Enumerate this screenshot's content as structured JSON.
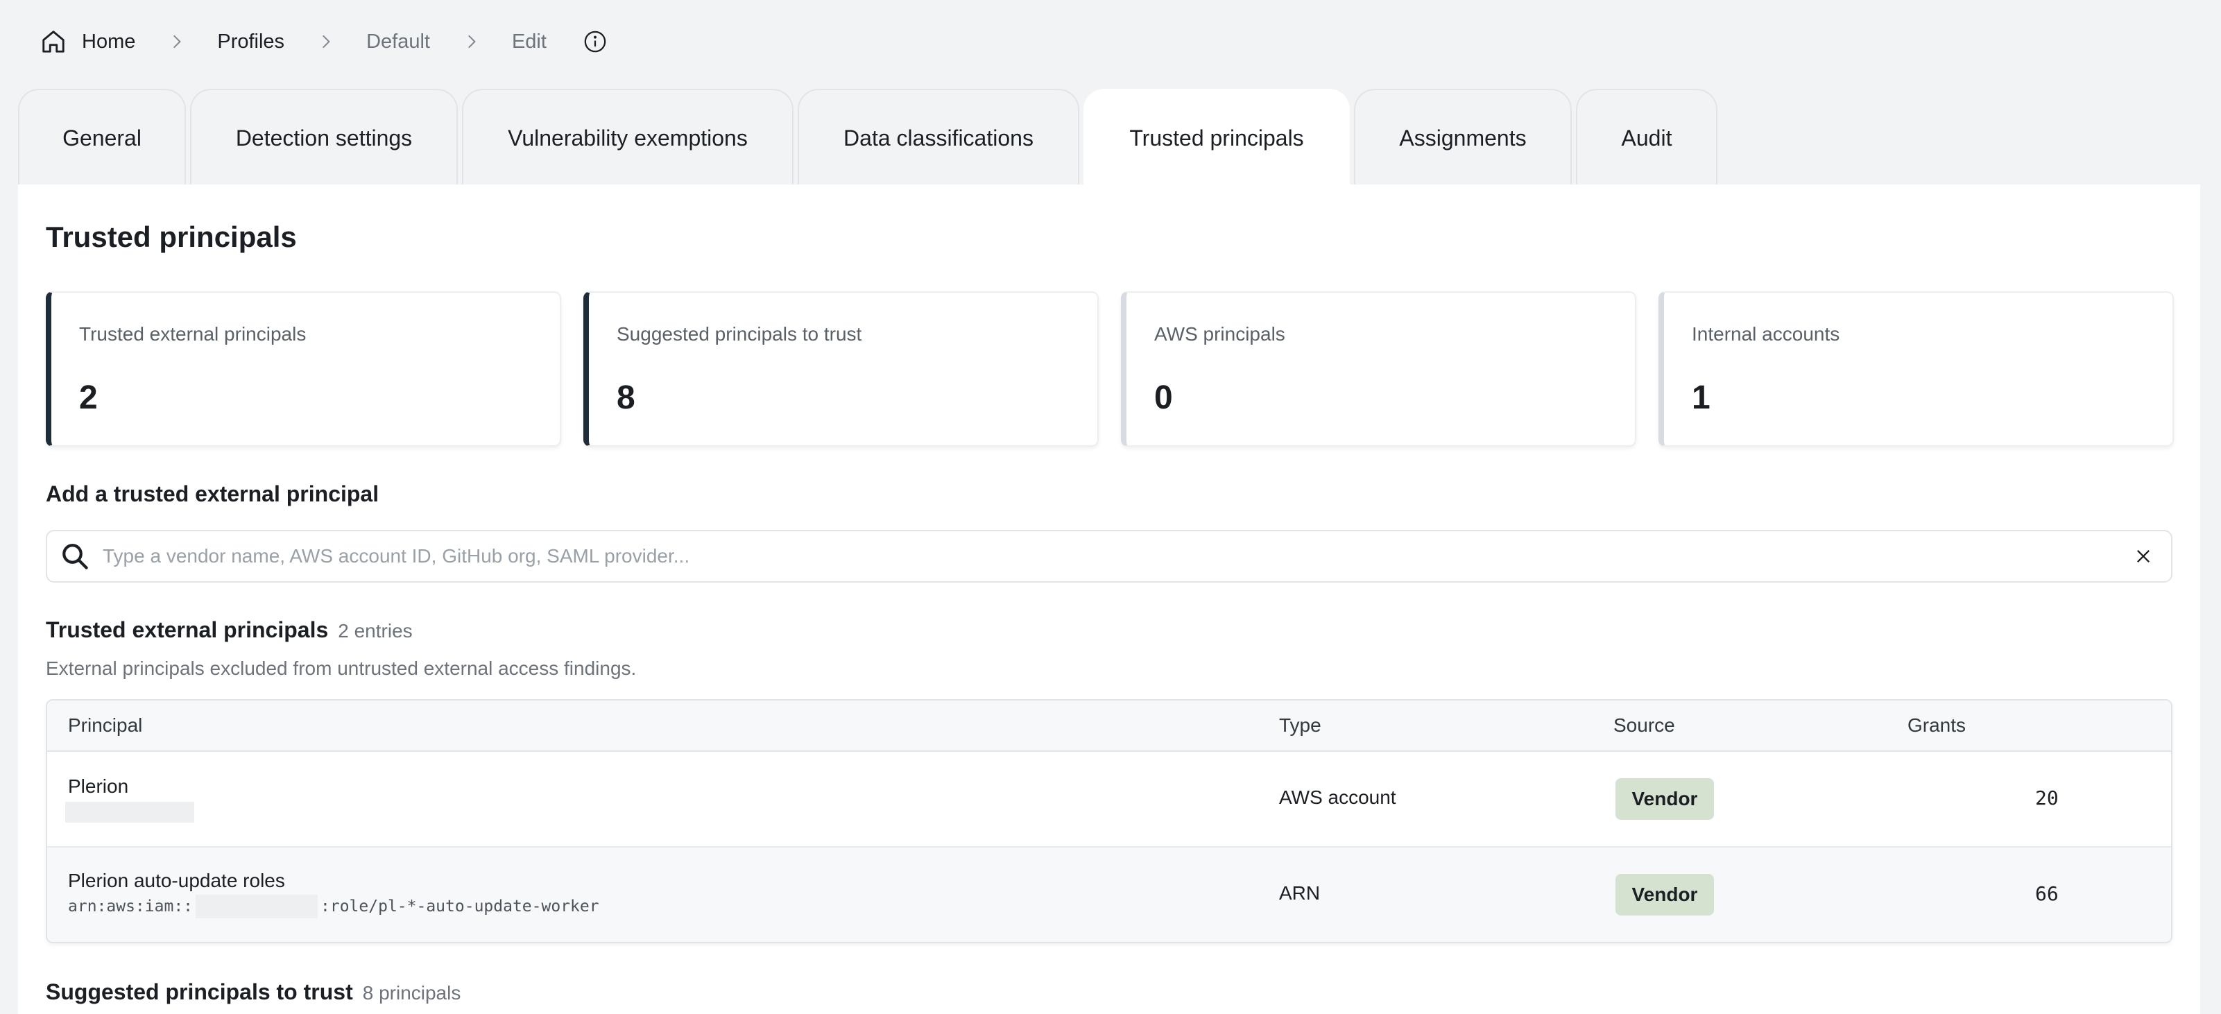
{
  "breadcrumb": {
    "items": [
      "Home",
      "Profiles",
      "Default",
      "Edit"
    ]
  },
  "tabs": [
    {
      "label": "General"
    },
    {
      "label": "Detection settings"
    },
    {
      "label": "Vulnerability exemptions"
    },
    {
      "label": "Data classifications"
    },
    {
      "label": "Trusted principals",
      "active": true
    },
    {
      "label": "Assignments"
    },
    {
      "label": "Audit"
    }
  ],
  "page": {
    "title": "Trusted principals"
  },
  "stats": [
    {
      "label": "Trusted external principals",
      "value": "2"
    },
    {
      "label": "Suggested principals to trust",
      "value": "8"
    },
    {
      "label": "AWS principals",
      "value": "0"
    },
    {
      "label": "Internal accounts",
      "value": "1"
    }
  ],
  "add": {
    "title": "Add a trusted external principal",
    "placeholder": "Type a vendor name, AWS account ID, GitHub org, SAML provider...",
    "value": ""
  },
  "trusted": {
    "title": "Trusted external principals",
    "count": "2 entries",
    "description": "External principals excluded from untrusted external access findings.",
    "columns": [
      "Principal",
      "Type",
      "Source",
      "Grants"
    ],
    "rows": [
      {
        "principal": "Plerion",
        "subtitle": "",
        "type": "AWS account",
        "source": "Vendor",
        "grants": "20"
      },
      {
        "principal": "Plerion auto-update roles",
        "arn_prefix": "arn:aws:iam::",
        "arn_suffix": ":role/pl-*-auto-update-worker",
        "type": "ARN",
        "source": "Vendor",
        "grants": "66"
      }
    ]
  },
  "suggested": {
    "title": "Suggested principals to trust",
    "count": "8 principals"
  },
  "colors": {
    "accent_dark": "#1f2d3a",
    "badge_vendor": "#d4e2cf",
    "background": "#f2f3f5"
  }
}
